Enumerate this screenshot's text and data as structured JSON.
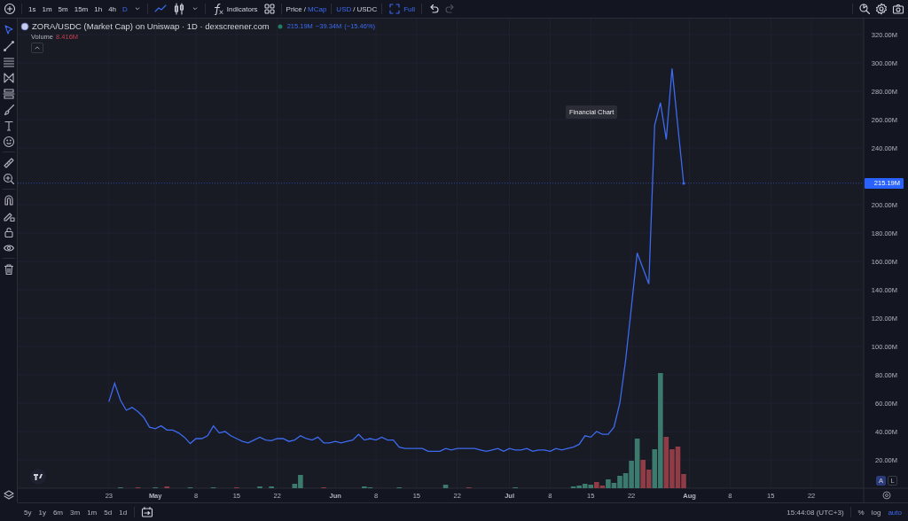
{
  "toolbar": {
    "intervals": [
      {
        "label": "1s",
        "selected": false
      },
      {
        "label": "1m",
        "selected": false
      },
      {
        "label": "5m",
        "selected": false
      },
      {
        "label": "15m",
        "selected": false
      },
      {
        "label": "1h",
        "selected": false
      },
      {
        "label": "4h",
        "selected": false
      },
      {
        "label": "D",
        "selected": true
      }
    ],
    "chart_types": [
      {
        "kind": "line",
        "selected": true
      },
      {
        "kind": "candles",
        "selected": false
      }
    ],
    "indicators": "Indicators",
    "price_mode": {
      "options": [
        {
          "label": "Price",
          "selected": false
        },
        {
          "label": "MCap",
          "selected": true
        }
      ],
      "separator": "/"
    },
    "currency": {
      "options": [
        {
          "label": "USD",
          "selected": true
        },
        {
          "label": "USDC",
          "selected": false
        }
      ],
      "separator": "/"
    },
    "full": {
      "label": "Full",
      "on": true
    },
    "history": [
      {
        "kind": "undo",
        "disabled": false
      },
      {
        "kind": "redo",
        "disabled": true
      }
    ]
  },
  "left_toolbar": {
    "tools": [
      {
        "selected": true
      },
      {
        "selected": false
      },
      {
        "selected": false
      },
      {
        "selected": false
      },
      {
        "selected": false
      },
      {
        "selected": false
      },
      {
        "selected": false
      },
      {
        "selected": false
      },
      {
        "selected": false
      },
      {
        "selected": false
      },
      {
        "selected": false
      },
      {
        "selected": false
      },
      {
        "selected": false
      },
      {
        "selected": false
      },
      {
        "selected": false
      }
    ]
  },
  "legend": {
    "title": "ZORA/USDC (Market Cap) on Uniswap · 1D · dexscreener.com",
    "value": "215.19M",
    "change": "−39.34M",
    "change_percent": "(−15.46%)",
    "volume_label": "Volume",
    "volume_value": "8.416M"
  },
  "tooltip": "Financial Chart",
  "last_price_label": "215.19M",
  "chart_data": {
    "type": "line",
    "categories": [
      "23",
      null,
      null,
      null,
      null,
      null,
      null,
      null,
      "May",
      null,
      null,
      null,
      null,
      null,
      null,
      "8",
      null,
      null,
      null,
      null,
      null,
      null,
      "15",
      null,
      null,
      null,
      null,
      null,
      null,
      "22",
      null,
      null,
      null,
      null,
      null,
      null,
      null,
      null,
      null,
      "Jun",
      null,
      null,
      null,
      null,
      null,
      null,
      "8",
      null,
      null,
      null,
      null,
      null,
      null,
      "15",
      null,
      null,
      null,
      null,
      null,
      null,
      "22",
      null,
      null,
      null,
      null,
      null,
      null,
      null,
      null,
      "Jul",
      null,
      null,
      null,
      null,
      null,
      null,
      "8",
      null,
      null,
      null,
      null,
      null,
      null,
      "15",
      null,
      null,
      null,
      null,
      null,
      null,
      "22",
      null,
      null,
      null,
      null,
      null,
      null,
      null,
      null,
      null,
      "Aug",
      null,
      null,
      null,
      null,
      null,
      null,
      "8",
      null,
      null,
      null,
      null,
      null,
      null,
      "15",
      null,
      null,
      null,
      null,
      null,
      null,
      "22"
    ],
    "series": [
      {
        "color": "#3d6bf0",
        "values": [
          61,
          74,
          62,
          55,
          57,
          54,
          50,
          43,
          42,
          44,
          41,
          41,
          39,
          36,
          31.5,
          35,
          35,
          37,
          44,
          39,
          40,
          37,
          35,
          33,
          32,
          34,
          36,
          34,
          33.5,
          35,
          35,
          33,
          34,
          37,
          35,
          34,
          36,
          32,
          32,
          33,
          32,
          33,
          34,
          38,
          34,
          35,
          34,
          36,
          34,
          34,
          29,
          28,
          28,
          28,
          28,
          26,
          26,
          26,
          28,
          27,
          28,
          28,
          28,
          28,
          27,
          26,
          27,
          28,
          26,
          28,
          27,
          27,
          28,
          26,
          27,
          27,
          26,
          28,
          27,
          28,
          29,
          31,
          37,
          36,
          40,
          38,
          38,
          43,
          60,
          90,
          128,
          166,
          155,
          144,
          256,
          272,
          246,
          296,
          255,
          215,
          null,
          null,
          null,
          null,
          null,
          null,
          null,
          null,
          null,
          null,
          null,
          null,
          null,
          null,
          null,
          null,
          null,
          null,
          null,
          null,
          null,
          null
        ]
      }
    ],
    "ylim": [
      0,
      331.25
    ],
    "grid": true,
    "ref_lines": [
      {
        "axis": "y",
        "value": 215.19
      }
    ],
    "yticks": [
      {
        "value": 20,
        "label": "20.00M"
      },
      {
        "value": 40,
        "label": "40.00M"
      },
      {
        "value": 60,
        "label": "60.00M"
      },
      {
        "value": 80,
        "label": "80.00M"
      },
      {
        "value": 100,
        "label": "100.00M"
      },
      {
        "value": 120,
        "label": "120.00M"
      },
      {
        "value": 140,
        "label": "140.00M"
      },
      {
        "value": 160,
        "label": "160.00M"
      },
      {
        "value": 180,
        "label": "180.00M"
      },
      {
        "value": 200,
        "label": "200.00M"
      },
      {
        "value": 240,
        "label": "240.00M"
      },
      {
        "value": 260,
        "label": "260.00M"
      },
      {
        "value": 280,
        "label": "280.00M"
      },
      {
        "value": 300,
        "label": "300.00M"
      },
      {
        "value": 320,
        "label": "320.00M"
      }
    ]
  },
  "scale_buttons": [
    {
      "label": "A",
      "on": true
    },
    {
      "label": "L",
      "on": false
    }
  ],
  "ranges": [
    "5y",
    "1y",
    "6m",
    "3m",
    "1m",
    "5d",
    "1d"
  ],
  "clock": "15:44:08 (UTC+3)",
  "scale_options": [
    {
      "label": "%",
      "on": false
    },
    {
      "label": "log",
      "on": false
    },
    {
      "label": "auto",
      "on": true
    }
  ]
}
